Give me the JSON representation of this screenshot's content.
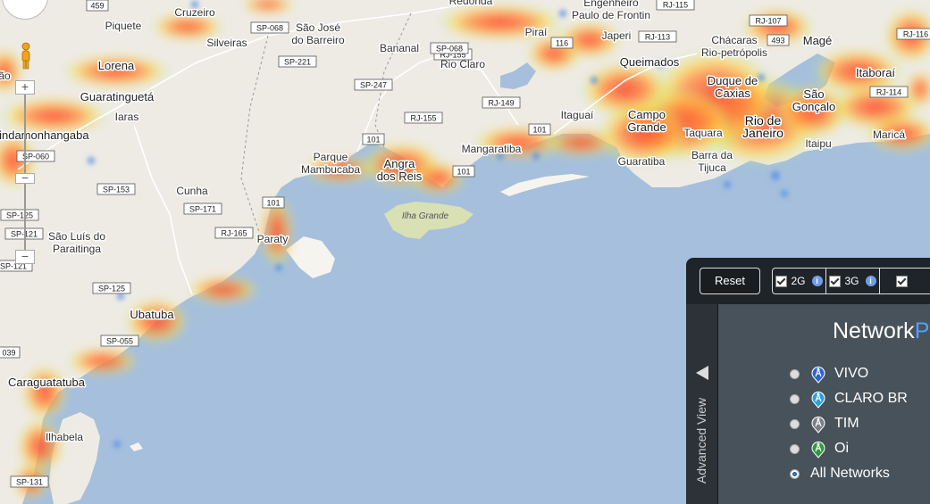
{
  "map": {
    "places": [
      {
        "name": "Cruzeiro",
        "kind": "town"
      },
      {
        "name": "Piquete",
        "kind": "town"
      },
      {
        "name": "Silveiras",
        "kind": "town"
      },
      {
        "name": "São José\ndo Barreiro",
        "kind": "town"
      },
      {
        "name": "Bananal",
        "kind": "town"
      },
      {
        "name": "Rio Claro",
        "kind": "town"
      },
      {
        "name": "Redonda",
        "kind": "town"
      },
      {
        "name": "Engenheiro\nPaulo de Frontin",
        "kind": "town"
      },
      {
        "name": "Japeri",
        "kind": "town"
      },
      {
        "name": "Piraí",
        "kind": "town"
      },
      {
        "name": "Queimados",
        "kind": "big"
      },
      {
        "name": "Chácaras\nRio-petrópolis",
        "kind": "town"
      },
      {
        "name": "Magé",
        "kind": "big"
      },
      {
        "name": "Duque de\nCaxias",
        "kind": "big"
      },
      {
        "name": "Rio de\nJaneiro",
        "kind": "city"
      },
      {
        "name": "São\nGonçalo",
        "kind": "big"
      },
      {
        "name": "Itaboraí",
        "kind": "big"
      },
      {
        "name": "Maricá",
        "kind": "town"
      },
      {
        "name": "Itaipu",
        "kind": "town"
      },
      {
        "name": "Taquara",
        "kind": "town"
      },
      {
        "name": "Barra da\nTijuca",
        "kind": "town"
      },
      {
        "name": "Campo\nGrande",
        "kind": "big"
      },
      {
        "name": "Guaratiba",
        "kind": "town"
      },
      {
        "name": "Itaguaí",
        "kind": "town"
      },
      {
        "name": "Mangaratiba",
        "kind": "town"
      },
      {
        "name": "Angra\ndos Reis",
        "kind": "big"
      },
      {
        "name": "Parque\nMambucaba",
        "kind": "town"
      },
      {
        "name": "Ilha Grande",
        "kind": "island"
      },
      {
        "name": "Paraty",
        "kind": "town"
      },
      {
        "name": "Lorena",
        "kind": "big"
      },
      {
        "name": "Guaratinguetá",
        "kind": "big"
      },
      {
        "name": "Iaras",
        "kind": "town"
      },
      {
        "name": "Cunha",
        "kind": "town"
      },
      {
        "name": "São Luís do\nParaitinga",
        "kind": "town"
      },
      {
        "name": "Pindamonhangaba",
        "kind": "big"
      },
      {
        "name": "Ubatuba",
        "kind": "big"
      },
      {
        "name": "Caraguatatuba",
        "kind": "big"
      },
      {
        "name": "Ilhabela",
        "kind": "town"
      },
      {
        "name": "ão",
        "kind": "town"
      }
    ],
    "roads": [
      "459",
      "SP-068",
      "SP-221",
      "SP-247",
      "RJ-155",
      "SP-068",
      "RJ-155",
      "RJ-149",
      "RJ-115",
      "RJ-107",
      "116",
      "RJ-113",
      "493",
      "RJ-116",
      "RJ-114",
      "101",
      "101",
      "101",
      "101",
      "SP-153",
      "SP-171",
      "RJ-165",
      "SP-125",
      "SP-055",
      "SP-121",
      "SP-060",
      "SP-125",
      "SP-121",
      "039",
      "SP-131"
    ]
  },
  "controls": {
    "zoom_in": "+",
    "zoom_out": "−",
    "zoom_out2": "−"
  },
  "panel": {
    "reset_label": "Reset",
    "filters": [
      {
        "label": "2G",
        "checked": true
      },
      {
        "label": "3G",
        "checked": true
      },
      {
        "label": "",
        "checked": true
      }
    ],
    "advanced_view_label": "Advanced View",
    "title_main": "Network",
    "title_accent": "P",
    "networks": [
      {
        "label": "VIVO",
        "pin_color": "#2b63d6",
        "selected": false
      },
      {
        "label": "CLARO BR",
        "pin_color": "#2a9fd8",
        "selected": false
      },
      {
        "label": "TIM",
        "pin_color": "#7a7f86",
        "selected": false
      },
      {
        "label": "Oi",
        "pin_color": "#2e9b3c",
        "selected": false
      },
      {
        "label": "All Networks",
        "pin_color": "",
        "selected": true
      }
    ],
    "info_glyph": "i"
  }
}
